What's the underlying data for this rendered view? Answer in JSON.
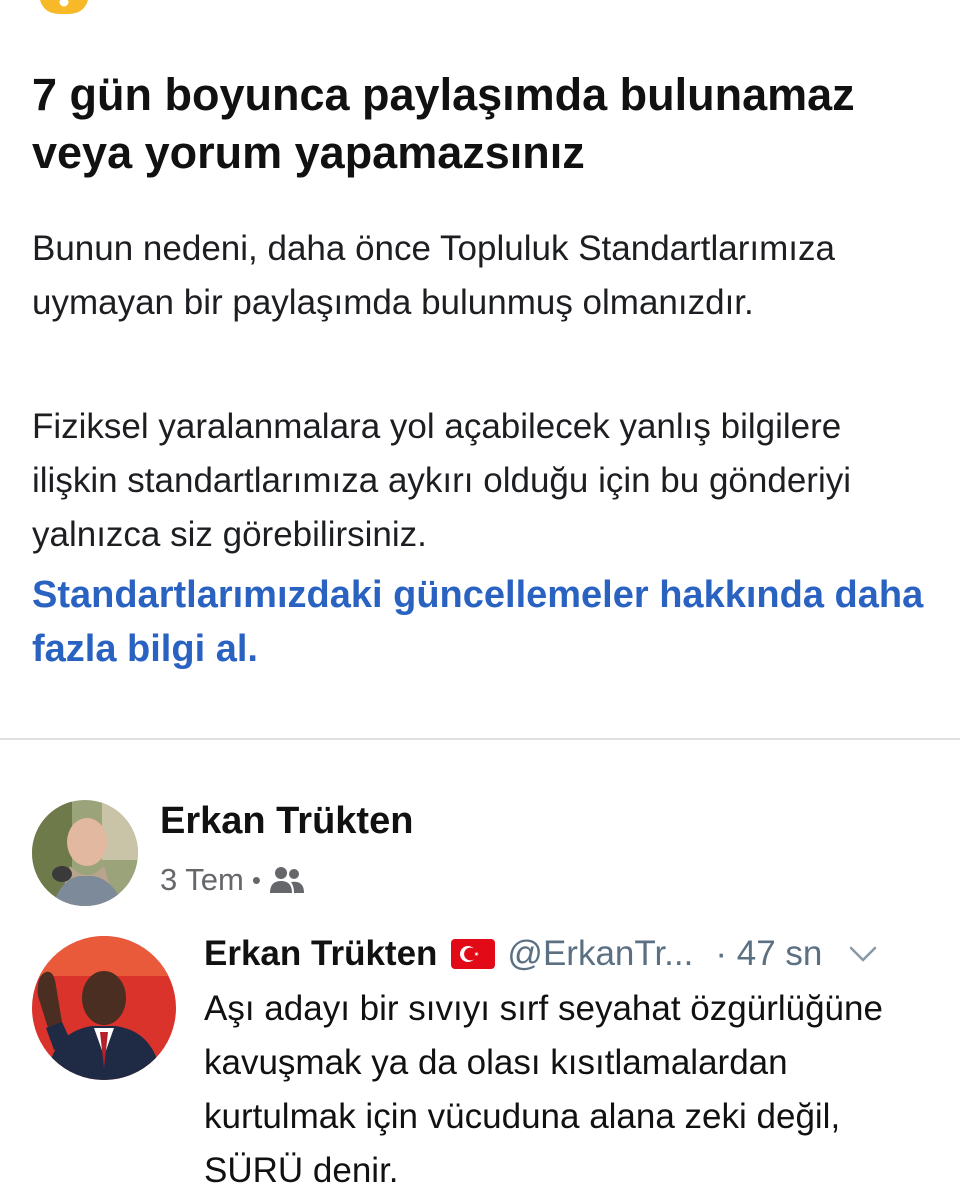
{
  "notice": {
    "title": "7 gün boyunca paylaşımda bulunamaz veya yorum yapamazsınız",
    "paragraph1": "Bunun nedeni, daha önce Topluluk Standartlarımıza uymayan bir paylaşımda bulunmuş olmanızdır.",
    "paragraph2": "Fiziksel yaralanmalara yol açabilecek yanlış bilgilere ilişkin standartlarımıza aykırı olduğu için bu gönderiyi yalnızca siz görebilirsiniz.",
    "link_text": "Standartlarımızdaki güncellemeler hakkında daha fazla bilgi al.",
    "icon": "warning-icon",
    "warning_color": "#f7b928",
    "link_color": "#2a62c2"
  },
  "post": {
    "author": "Erkan Trükten",
    "date": "3 Tem",
    "separator": "•",
    "audience_icon": "friends-icon"
  },
  "tweet": {
    "name": "Erkan Trükten",
    "flag_icon": "turkey-flag-icon",
    "handle": "@ErkanTr...",
    "time": "· 47 sn",
    "caret_icon": "chevron-down-icon",
    "text": "Aşı adayı bir sıvıyı sırf seyahat özgürlüğüne kavuşmak ya da olası kısıtlamalardan kurtulmak için vücuduna alana zeki değil, SÜRÜ denir."
  }
}
